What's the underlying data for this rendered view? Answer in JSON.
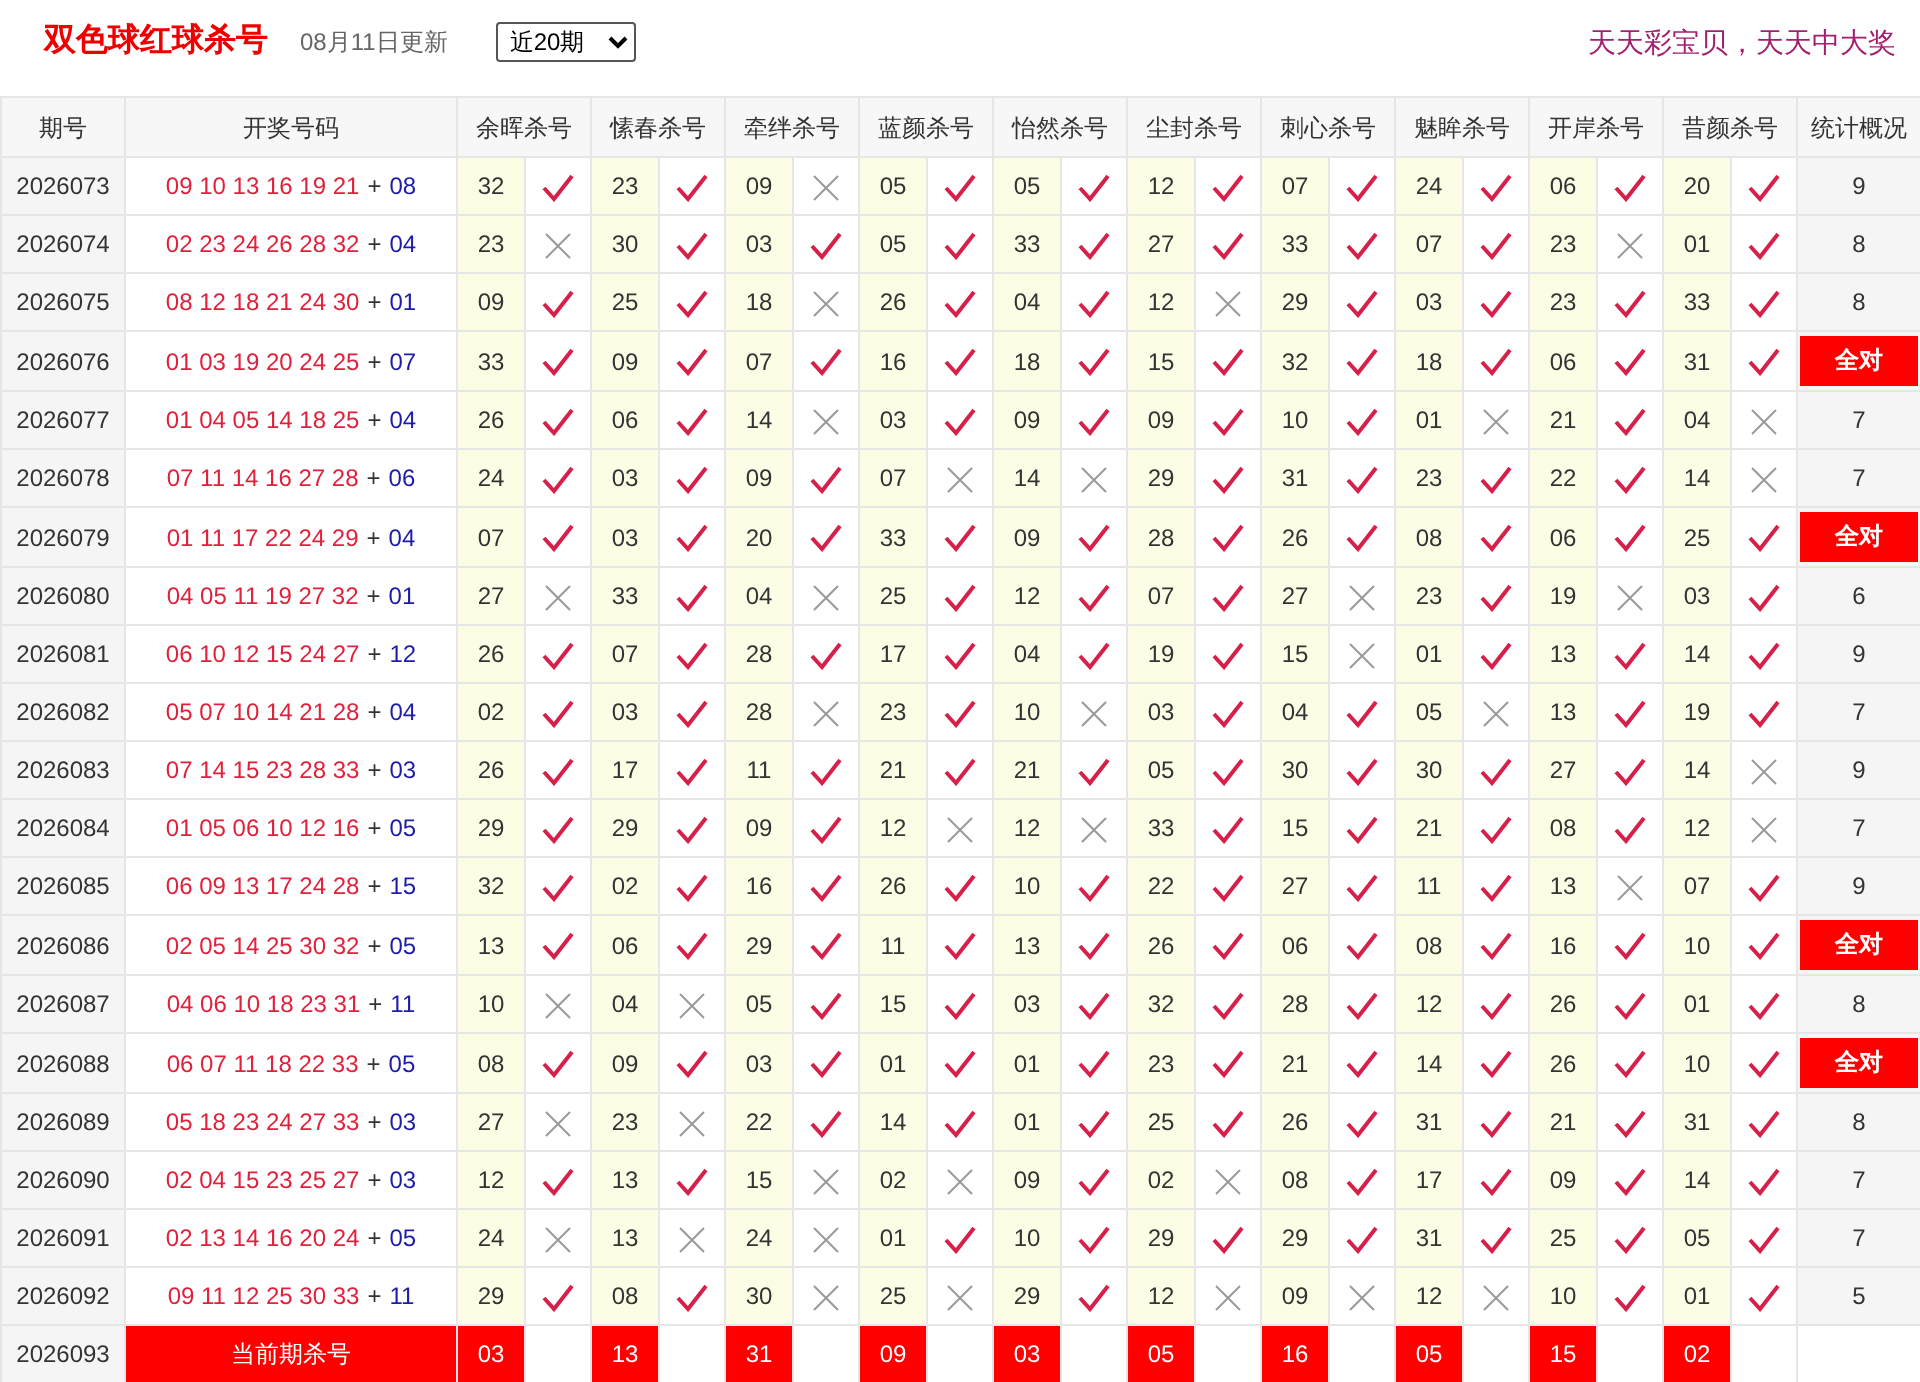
{
  "header": {
    "title": "双色球红球杀号",
    "updated": "08月11日更新",
    "period_select": {
      "value": "近20期"
    },
    "slogan": "天天彩宝贝，天天中大奖"
  },
  "columns": [
    "期号",
    "开奖号码",
    "余晖杀号",
    "愫春杀号",
    "牵绊杀号",
    "蓝颜杀号",
    "怡然杀号",
    "尘封杀号",
    "刺心杀号",
    "魅眸杀号",
    "开岸杀号",
    "昔颜杀号",
    "统计概况"
  ],
  "rows": [
    {
      "issue": "2026073",
      "reds": "09 10 13 16 19 21",
      "plus": "+",
      "blue": "08",
      "picks": [
        "32",
        "23",
        "09",
        "05",
        "05",
        "12",
        "07",
        "24",
        "06",
        "20"
      ],
      "hits": [
        true,
        true,
        false,
        true,
        true,
        true,
        true,
        true,
        true,
        true
      ],
      "summary": "9",
      "all_correct": false
    },
    {
      "issue": "2026074",
      "reds": "02 23 24 26 28 32",
      "plus": "+",
      "blue": "04",
      "picks": [
        "23",
        "30",
        "03",
        "05",
        "33",
        "27",
        "33",
        "07",
        "23",
        "01"
      ],
      "hits": [
        false,
        true,
        true,
        true,
        true,
        true,
        true,
        true,
        false,
        true
      ],
      "summary": "8",
      "all_correct": false
    },
    {
      "issue": "2026075",
      "reds": "08 12 18 21 24 30",
      "plus": "+",
      "blue": "01",
      "picks": [
        "09",
        "25",
        "18",
        "26",
        "04",
        "12",
        "29",
        "03",
        "23",
        "33"
      ],
      "hits": [
        true,
        true,
        false,
        true,
        true,
        false,
        true,
        true,
        true,
        true
      ],
      "summary": "8",
      "all_correct": false
    },
    {
      "issue": "2026076",
      "reds": "01 03 19 20 24 25",
      "plus": "+",
      "blue": "07",
      "picks": [
        "33",
        "09",
        "07",
        "16",
        "18",
        "15",
        "32",
        "18",
        "06",
        "31"
      ],
      "hits": [
        true,
        true,
        true,
        true,
        true,
        true,
        true,
        true,
        true,
        true
      ],
      "summary": "全对",
      "all_correct": true
    },
    {
      "issue": "2026077",
      "reds": "01 04 05 14 18 25",
      "plus": "+",
      "blue": "04",
      "picks": [
        "26",
        "06",
        "14",
        "03",
        "09",
        "09",
        "10",
        "01",
        "21",
        "04"
      ],
      "hits": [
        true,
        true,
        false,
        true,
        true,
        true,
        true,
        false,
        true,
        false
      ],
      "summary": "7",
      "all_correct": false
    },
    {
      "issue": "2026078",
      "reds": "07 11 14 16 27 28",
      "plus": "+",
      "blue": "06",
      "picks": [
        "24",
        "03",
        "09",
        "07",
        "14",
        "29",
        "31",
        "23",
        "22",
        "14"
      ],
      "hits": [
        true,
        true,
        true,
        false,
        false,
        true,
        true,
        true,
        true,
        false
      ],
      "summary": "7",
      "all_correct": false
    },
    {
      "issue": "2026079",
      "reds": "01 11 17 22 24 29",
      "plus": "+",
      "blue": "04",
      "picks": [
        "07",
        "03",
        "20",
        "33",
        "09",
        "28",
        "26",
        "08",
        "06",
        "25"
      ],
      "hits": [
        true,
        true,
        true,
        true,
        true,
        true,
        true,
        true,
        true,
        true
      ],
      "summary": "全对",
      "all_correct": true
    },
    {
      "issue": "2026080",
      "reds": "04 05 11 19 27 32",
      "plus": "+",
      "blue": "01",
      "picks": [
        "27",
        "33",
        "04",
        "25",
        "12",
        "07",
        "27",
        "23",
        "19",
        "03"
      ],
      "hits": [
        false,
        true,
        false,
        true,
        true,
        true,
        false,
        true,
        false,
        true
      ],
      "summary": "6",
      "all_correct": false
    },
    {
      "issue": "2026081",
      "reds": "06 10 12 15 24 27",
      "plus": "+",
      "blue": "12",
      "picks": [
        "26",
        "07",
        "28",
        "17",
        "04",
        "19",
        "15",
        "01",
        "13",
        "14"
      ],
      "hits": [
        true,
        true,
        true,
        true,
        true,
        true,
        false,
        true,
        true,
        true
      ],
      "summary": "9",
      "all_correct": false
    },
    {
      "issue": "2026082",
      "reds": "05 07 10 14 21 28",
      "plus": "+",
      "blue": "04",
      "picks": [
        "02",
        "03",
        "28",
        "23",
        "10",
        "03",
        "04",
        "05",
        "13",
        "19"
      ],
      "hits": [
        true,
        true,
        false,
        true,
        false,
        true,
        true,
        false,
        true,
        true
      ],
      "summary": "7",
      "all_correct": false
    },
    {
      "issue": "2026083",
      "reds": "07 14 15 23 28 33",
      "plus": "+",
      "blue": "03",
      "picks": [
        "26",
        "17",
        "11",
        "21",
        "21",
        "05",
        "30",
        "30",
        "27",
        "14"
      ],
      "hits": [
        true,
        true,
        true,
        true,
        true,
        true,
        true,
        true,
        true,
        false
      ],
      "summary": "9",
      "all_correct": false
    },
    {
      "issue": "2026084",
      "reds": "01 05 06 10 12 16",
      "plus": "+",
      "blue": "05",
      "picks": [
        "29",
        "29",
        "09",
        "12",
        "12",
        "33",
        "15",
        "21",
        "08",
        "12"
      ],
      "hits": [
        true,
        true,
        true,
        false,
        false,
        true,
        true,
        true,
        true,
        false
      ],
      "summary": "7",
      "all_correct": false
    },
    {
      "issue": "2026085",
      "reds": "06 09 13 17 24 28",
      "plus": "+",
      "blue": "15",
      "picks": [
        "32",
        "02",
        "16",
        "26",
        "10",
        "22",
        "27",
        "11",
        "13",
        "07"
      ],
      "hits": [
        true,
        true,
        true,
        true,
        true,
        true,
        true,
        true,
        false,
        true
      ],
      "summary": "9",
      "all_correct": false
    },
    {
      "issue": "2026086",
      "reds": "02 05 14 25 30 32",
      "plus": "+",
      "blue": "05",
      "picks": [
        "13",
        "06",
        "29",
        "11",
        "13",
        "26",
        "06",
        "08",
        "16",
        "10"
      ],
      "hits": [
        true,
        true,
        true,
        true,
        true,
        true,
        true,
        true,
        true,
        true
      ],
      "summary": "全对",
      "all_correct": true
    },
    {
      "issue": "2026087",
      "reds": "04 06 10 18 23 31",
      "plus": "+",
      "blue": "11",
      "picks": [
        "10",
        "04",
        "05",
        "15",
        "03",
        "32",
        "28",
        "12",
        "26",
        "01"
      ],
      "hits": [
        false,
        false,
        true,
        true,
        true,
        true,
        true,
        true,
        true,
        true
      ],
      "summary": "8",
      "all_correct": false
    },
    {
      "issue": "2026088",
      "reds": "06 07 11 18 22 33",
      "plus": "+",
      "blue": "05",
      "picks": [
        "08",
        "09",
        "03",
        "01",
        "01",
        "23",
        "21",
        "14",
        "26",
        "10"
      ],
      "hits": [
        true,
        true,
        true,
        true,
        true,
        true,
        true,
        true,
        true,
        true
      ],
      "summary": "全对",
      "all_correct": true
    },
    {
      "issue": "2026089",
      "reds": "05 18 23 24 27 33",
      "plus": "+",
      "blue": "03",
      "picks": [
        "27",
        "23",
        "22",
        "14",
        "01",
        "25",
        "26",
        "31",
        "21",
        "31"
      ],
      "hits": [
        false,
        false,
        true,
        true,
        true,
        true,
        true,
        true,
        true,
        true
      ],
      "summary": "8",
      "all_correct": false
    },
    {
      "issue": "2026090",
      "reds": "02 04 15 23 25 27",
      "plus": "+",
      "blue": "03",
      "picks": [
        "12",
        "13",
        "15",
        "02",
        "09",
        "02",
        "08",
        "17",
        "09",
        "14"
      ],
      "hits": [
        true,
        true,
        false,
        false,
        true,
        false,
        true,
        true,
        true,
        true
      ],
      "summary": "7",
      "all_correct": false
    },
    {
      "issue": "2026091",
      "reds": "02 13 14 16 20 24",
      "plus": "+",
      "blue": "05",
      "picks": [
        "24",
        "13",
        "24",
        "01",
        "10",
        "29",
        "29",
        "31",
        "25",
        "05"
      ],
      "hits": [
        false,
        false,
        false,
        true,
        true,
        true,
        true,
        true,
        true,
        true
      ],
      "summary": "7",
      "all_correct": false
    },
    {
      "issue": "2026092",
      "reds": "09 11 12 25 30 33",
      "plus": "+",
      "blue": "11",
      "picks": [
        "29",
        "08",
        "30",
        "25",
        "29",
        "12",
        "09",
        "12",
        "10",
        "01"
      ],
      "hits": [
        true,
        true,
        false,
        false,
        true,
        false,
        false,
        false,
        true,
        true
      ],
      "summary": "5",
      "all_correct": false
    }
  ],
  "current": {
    "issue": "2026093",
    "label": "当前期杀号",
    "picks": [
      "03",
      "13",
      "31",
      "09",
      "03",
      "05",
      "16",
      "05",
      "15",
      "02"
    ]
  }
}
